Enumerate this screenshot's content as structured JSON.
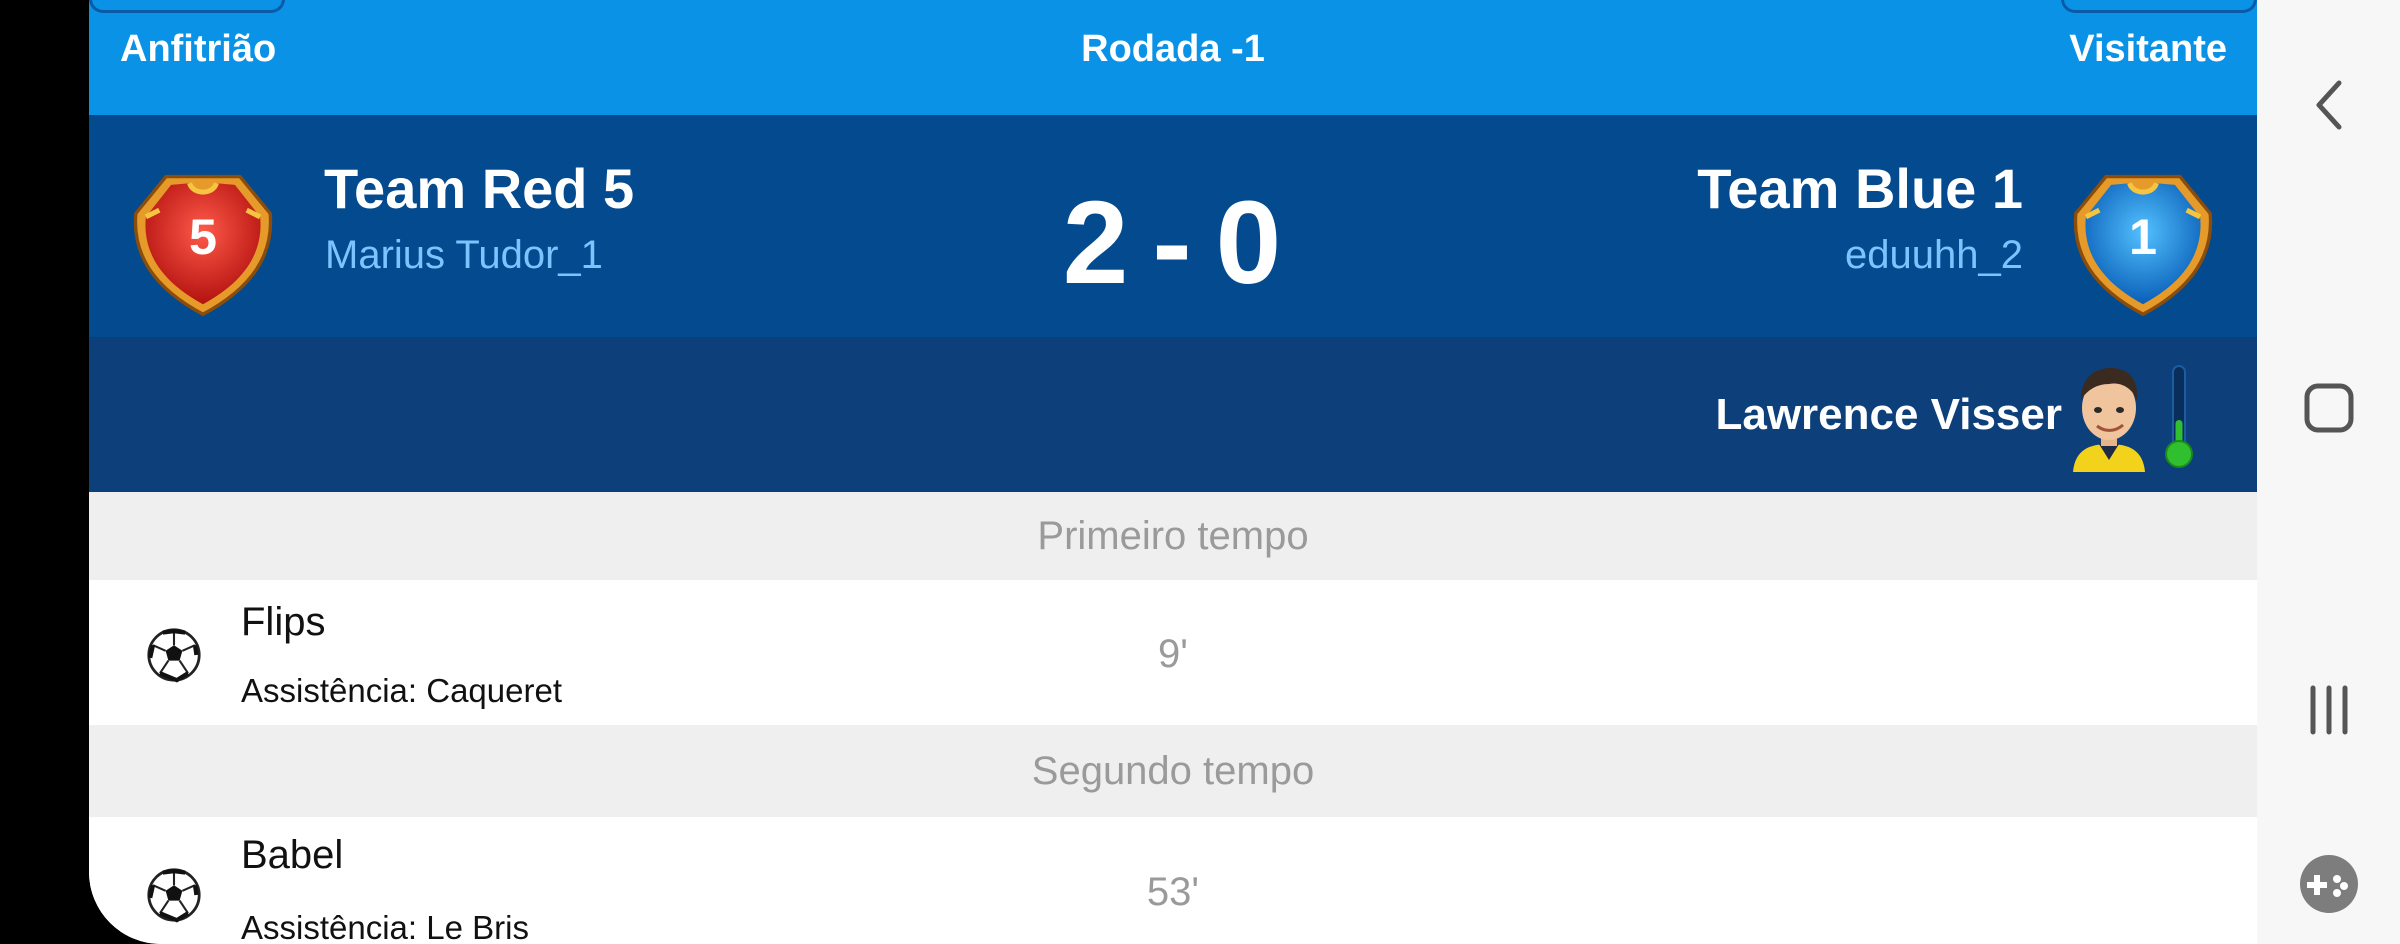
{
  "header": {
    "home_label": "Anfitrião",
    "round_label": "Rodada -1",
    "away_label": "Visitante"
  },
  "match": {
    "home": {
      "team": "Team Red 5",
      "manager": "Marius Tudor_1",
      "shirt_number": "5",
      "color": "#d21d1d"
    },
    "away": {
      "team": "Team Blue 1",
      "manager": "eduuhh_2",
      "shirt_number": "1",
      "color": "#1a8de0"
    },
    "score_home": "2",
    "score_sep": "-",
    "score_away": "0"
  },
  "referee": {
    "name": "Lawrence Visser",
    "icon": "referee-avatar",
    "thermometer_level": 0.25
  },
  "timeline": {
    "first_half_label": "Primeiro tempo",
    "second_half_label": "Segundo tempo",
    "events": [
      {
        "player": "Flips",
        "assist": "Assistência: Caqueret",
        "minute": "9'",
        "icon": "soccer-ball"
      },
      {
        "player": "Babel",
        "assist": "Assistência: Le Bris",
        "minute": "53'",
        "icon": "soccer-ball"
      }
    ]
  },
  "navbar": {
    "icons": [
      "back-icon",
      "home-icon",
      "recents-icon",
      "game-launcher-icon"
    ]
  },
  "colors": {
    "header_blue": "#0992e6",
    "score_navy": "#034a8f",
    "referee_navy": "#0d3f7a",
    "manager_light_blue": "#7cc4ff"
  }
}
